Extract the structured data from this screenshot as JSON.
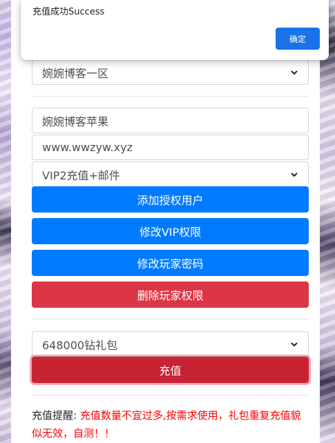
{
  "dialog": {
    "message": "充值成功Success",
    "ok_label": "确定"
  },
  "server_select": {
    "value": "婉婉博客一区"
  },
  "player_fields": {
    "name": "婉婉博客苹果",
    "password": "www.wwzyw.xyz",
    "vip_select_value": "VIP2充值+邮件"
  },
  "actions": {
    "add_auth_user": "添加授权用户",
    "modify_vip": "修改VIP权限",
    "modify_password": "修改玩家密码",
    "delete_permission": "删除玩家权限"
  },
  "recharge": {
    "package_select_value": "648000钻礼包",
    "recharge_button": "充值"
  },
  "notice": {
    "label": "充值提醒:",
    "text": "充值数量不宜过多,按需求使用，礼包重复充值貌似无效，自测！！"
  },
  "colors": {
    "primary": "#007bff",
    "danger": "#dc3545",
    "danger_active": "#c82333",
    "notice_red": "#ff0000",
    "dialog_button": "#1a73e8"
  },
  "icons": {
    "select_caret": "chevron-down-icon"
  }
}
